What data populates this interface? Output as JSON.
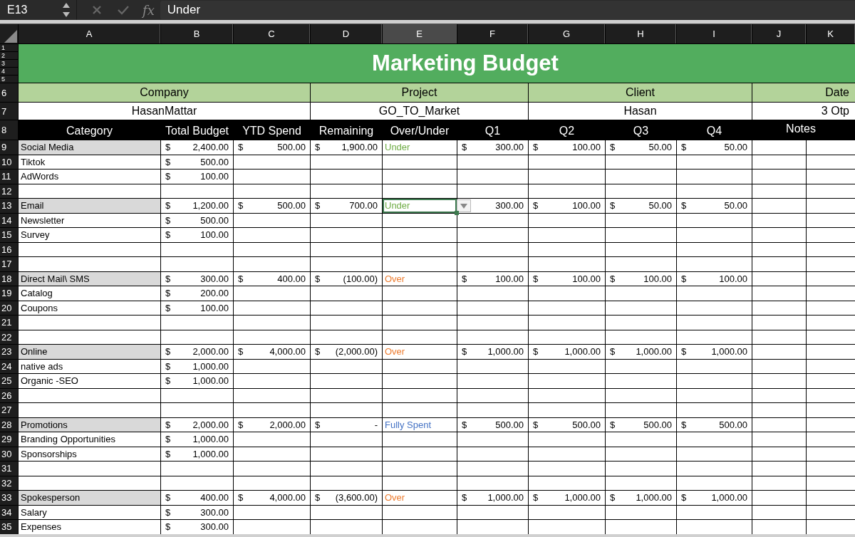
{
  "formula_bar": {
    "cell_ref": "E13",
    "function_label": "fx",
    "formula": "Under"
  },
  "column_headers": [
    {
      "label": "A",
      "selected": false
    },
    {
      "label": "B",
      "selected": false
    },
    {
      "label": "C",
      "selected": false
    },
    {
      "label": "D",
      "selected": false
    },
    {
      "label": "E",
      "selected": true
    },
    {
      "label": "F",
      "selected": false
    },
    {
      "label": "G",
      "selected": false
    },
    {
      "label": "H",
      "selected": false
    },
    {
      "label": "I",
      "selected": false
    },
    {
      "label": "J",
      "selected": false
    },
    {
      "label": "K",
      "selected": false
    }
  ],
  "title_rows": [
    "1",
    "2",
    "3",
    "4",
    "5"
  ],
  "title": "Marketing Budget",
  "info": [
    {
      "label": "Company",
      "value": "HasanMattar"
    },
    {
      "label": "Project",
      "value": "GO_TO_Market"
    },
    {
      "label": "Client",
      "value": "Hasan"
    },
    {
      "label": "Date",
      "value": "3 Otp"
    }
  ],
  "info_rows": [
    "6",
    "7"
  ],
  "header_row": "8",
  "columns": [
    "Category",
    "Total Budget",
    "YTD Spend",
    "Remaining",
    "Over/Under",
    "Q1",
    "Q2",
    "Q3",
    "Q4",
    "Notes"
  ],
  "rows": [
    {
      "number": "9",
      "kind": "category",
      "label": "Social Media",
      "total": {
        "symbol": "$",
        "amount": "2,400.00"
      },
      "ytd": {
        "symbol": "$",
        "amount": "500.00"
      },
      "remaining": {
        "symbol": "$",
        "amount": "1,900.00"
      },
      "status": {
        "text": "Under",
        "kind": "under",
        "selected": false
      },
      "quarters": [
        {
          "symbol": "$",
          "amount": "300.00"
        },
        {
          "symbol": "$",
          "amount": "100.00"
        },
        {
          "symbol": "$",
          "amount": "50.00"
        },
        {
          "symbol": "$",
          "amount": "50.00"
        }
      ]
    },
    {
      "number": "10",
      "kind": "item",
      "label": "Tiktok",
      "total": {
        "symbol": "$",
        "amount": "500.00"
      }
    },
    {
      "number": "11",
      "kind": "item",
      "label": "AdWords",
      "total": {
        "symbol": "$",
        "amount": "100.00"
      }
    },
    {
      "number": "12",
      "kind": "blank"
    },
    {
      "number": "13",
      "kind": "category",
      "label": "Email",
      "total": {
        "symbol": "$",
        "amount": "1,200.00"
      },
      "ytd": {
        "symbol": "$",
        "amount": "500.00"
      },
      "remaining": {
        "symbol": "$",
        "amount": "700.00"
      },
      "status": {
        "text": "Under",
        "kind": "under",
        "selected": true
      },
      "quarters": [
        {
          "amount": "300.00"
        },
        {
          "symbol": "$",
          "amount": "100.00"
        },
        {
          "symbol": "$",
          "amount": "50.00"
        },
        {
          "symbol": "$",
          "amount": "50.00"
        }
      ]
    },
    {
      "number": "14",
      "kind": "item",
      "label": "Newsletter",
      "total": {
        "symbol": "$",
        "amount": "500.00"
      }
    },
    {
      "number": "15",
      "kind": "item",
      "label": "Survey",
      "total": {
        "symbol": "$",
        "amount": "100.00"
      }
    },
    {
      "number": "16",
      "kind": "blank"
    },
    {
      "number": "17",
      "kind": "blank"
    },
    {
      "number": "18",
      "kind": "category",
      "label": "Direct Mail\\ SMS",
      "total": {
        "symbol": "$",
        "amount": "300.00"
      },
      "ytd": {
        "symbol": "$",
        "amount": "400.00"
      },
      "remaining": {
        "symbol": "$",
        "amount": "(100.00)"
      },
      "status": {
        "text": "Over",
        "kind": "over",
        "selected": false
      },
      "quarters": [
        {
          "symbol": "$",
          "amount": "100.00"
        },
        {
          "symbol": "$",
          "amount": "100.00"
        },
        {
          "symbol": "$",
          "amount": "100.00"
        },
        {
          "symbol": "$",
          "amount": "100.00"
        }
      ]
    },
    {
      "number": "19",
      "kind": "item",
      "label": "Catalog",
      "total": {
        "symbol": "$",
        "amount": "200.00"
      }
    },
    {
      "number": "20",
      "kind": "item",
      "label": "Coupons",
      "total": {
        "symbol": "$",
        "amount": "100.00"
      }
    },
    {
      "number": "21",
      "kind": "blank"
    },
    {
      "number": "22",
      "kind": "blank"
    },
    {
      "number": "23",
      "kind": "category",
      "label": "Online",
      "total": {
        "symbol": "$",
        "amount": "2,000.00"
      },
      "ytd": {
        "symbol": "$",
        "amount": "4,000.00"
      },
      "remaining": {
        "symbol": "$",
        "amount": "(2,000.00)"
      },
      "status": {
        "text": "Over",
        "kind": "over",
        "selected": false
      },
      "quarters": [
        {
          "symbol": "$",
          "amount": "1,000.00"
        },
        {
          "symbol": "$",
          "amount": "1,000.00"
        },
        {
          "symbol": "$",
          "amount": "1,000.00"
        },
        {
          "symbol": "$",
          "amount": "1,000.00"
        }
      ]
    },
    {
      "number": "24",
      "kind": "item",
      "label": "native ads",
      "total": {
        "symbol": "$",
        "amount": "1,000.00"
      }
    },
    {
      "number": "25",
      "kind": "item",
      "label": "Organic -SEO",
      "total": {
        "symbol": "$",
        "amount": "1,000.00"
      }
    },
    {
      "number": "26",
      "kind": "blank"
    },
    {
      "number": "27",
      "kind": "blank"
    },
    {
      "number": "28",
      "kind": "category",
      "label": "Promotions",
      "total": {
        "symbol": "$",
        "amount": "2,000.00"
      },
      "ytd": {
        "symbol": "$",
        "amount": "2,000.00"
      },
      "remaining": {
        "symbol": "$",
        "amount": "-"
      },
      "status": {
        "text": "Fully Spent",
        "kind": "spent",
        "selected": false
      },
      "quarters": [
        {
          "symbol": "$",
          "amount": "500.00"
        },
        {
          "symbol": "$",
          "amount": "500.00"
        },
        {
          "symbol": "$",
          "amount": "500.00"
        },
        {
          "symbol": "$",
          "amount": "500.00"
        }
      ]
    },
    {
      "number": "29",
      "kind": "item",
      "label": "Branding Opportunities",
      "total": {
        "symbol": "$",
        "amount": "1,000.00"
      }
    },
    {
      "number": "30",
      "kind": "item",
      "label": "Sponsorships",
      "total": {
        "symbol": "$",
        "amount": "1,000.00"
      }
    },
    {
      "number": "31",
      "kind": "blank"
    },
    {
      "number": "32",
      "kind": "blank"
    },
    {
      "number": "33",
      "kind": "category",
      "label": "Spokesperson",
      "total": {
        "symbol": "$",
        "amount": "400.00"
      },
      "ytd": {
        "symbol": "$",
        "amount": "4,000.00"
      },
      "remaining": {
        "symbol": "$",
        "amount": "(3,600.00)"
      },
      "status": {
        "text": "Over",
        "kind": "over",
        "selected": false
      },
      "quarters": [
        {
          "symbol": "$",
          "amount": "1,000.00"
        },
        {
          "symbol": "$",
          "amount": "1,000.00"
        },
        {
          "symbol": "$",
          "amount": "1,000.00"
        },
        {
          "symbol": "$",
          "amount": "1,000.00"
        }
      ]
    },
    {
      "number": "34",
      "kind": "item",
      "label": "Salary",
      "total": {
        "symbol": "$",
        "amount": "300.00"
      }
    },
    {
      "number": "35",
      "kind": "item",
      "label": "Expenses",
      "total": {
        "symbol": "$",
        "amount": "300.00"
      }
    }
  ]
}
